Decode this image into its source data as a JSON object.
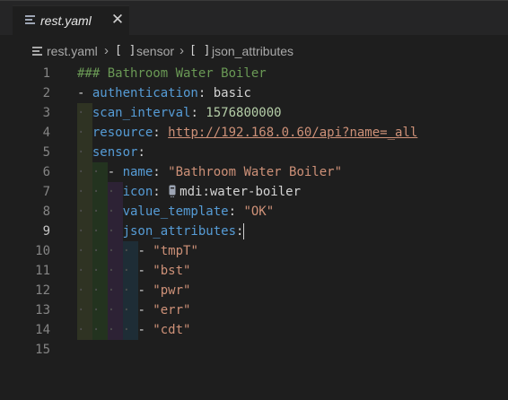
{
  "tab": {
    "filename": "rest.yaml",
    "close_glyph": "✕"
  },
  "breadcrumb": {
    "file": "rest.yaml",
    "separator": "›",
    "segments": [
      {
        "bracket": "[ ]",
        "label": "sensor"
      },
      {
        "bracket": "[ ]",
        "label": "json_attributes"
      }
    ]
  },
  "editor": {
    "active_line": 9,
    "line_numbers": [
      "1",
      "2",
      "3",
      "4",
      "5",
      "6",
      "7",
      "8",
      "9",
      "10",
      "11",
      "12",
      "13",
      "14",
      "15"
    ],
    "lines": {
      "l1_comment": "### Bathroom Water Boiler",
      "l2_dash": "- ",
      "l2_key": "authentication",
      "l2_colon": ": ",
      "l2_value": "basic",
      "l3_key": "scan_interval",
      "l3_colon": ": ",
      "l3_value": "1576800000",
      "l4_key": "resource",
      "l4_colon": ": ",
      "l4_value": "http://192.168.0.60/api?name=_all",
      "l5_key": "sensor",
      "l5_colon": ":",
      "l6_dash": "- ",
      "l6_key": "name",
      "l6_colon": ": ",
      "l6_value": "\"Bathroom Water Boiler\"",
      "l7_key": "icon",
      "l7_colon": ": ",
      "l7_value": "mdi:water-boiler",
      "l8_key": "value_template",
      "l8_colon": ": ",
      "l8_value": "\"OK\"",
      "l9_key": "json_attributes",
      "l9_colon": ":",
      "l10_value": "\"tmpT\"",
      "l11_value": "\"bst\"",
      "l12_value": "\"pwr\"",
      "l13_value": "\"err\"",
      "l14_value": "\"cdt\"",
      "list_dash": "- "
    },
    "colors": {
      "background": "#1e1e1e",
      "keyword": "#569cd6",
      "string": "#ce9178",
      "number": "#b5cea8",
      "comment": "#6a9955",
      "guide_level1": "#2f3323",
      "guide_level2": "#23331f",
      "guide_level3": "#2d2235",
      "guide_level4": "#1e2d36"
    }
  }
}
